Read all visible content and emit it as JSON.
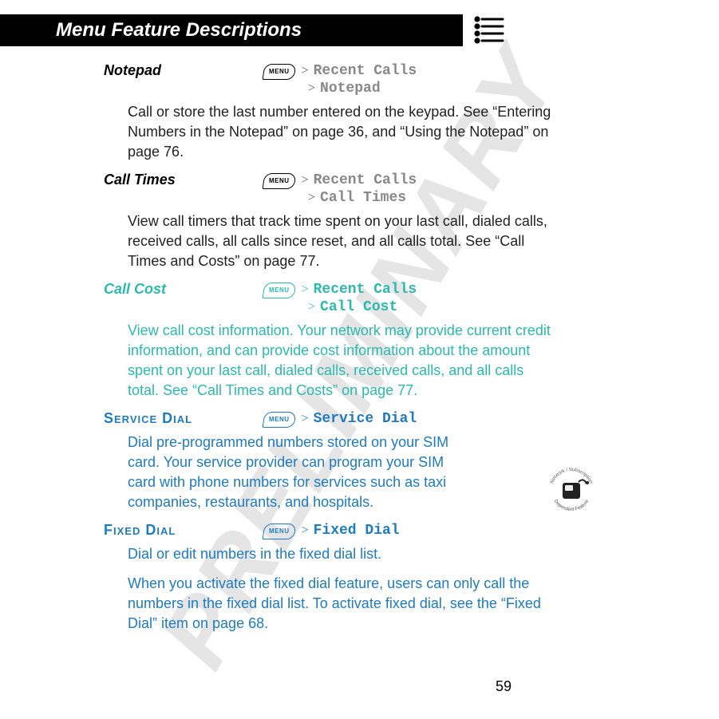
{
  "header": {
    "title": "Menu Feature Descriptions"
  },
  "watermark": "PRELIMINARY",
  "menu_button_label": "MENU",
  "sections": {
    "notepad": {
      "label": "Notepad",
      "crumb1": "Recent Calls",
      "crumb2": "Notepad",
      "body": "Call or store the last number entered on the keypad. See “Entering Numbers in the Notepad” on page 36, and “Using the Notepad” on page 76."
    },
    "calltimes": {
      "label": "Call Times",
      "crumb1": "Recent Calls",
      "crumb2": "Call Times",
      "body": "View call timers that track time spent on your last call, dialed calls, received calls, all calls since reset, and all calls total. See “Call Times and Costs” on page 77."
    },
    "callcost": {
      "label": "Call Cost",
      "crumb1": "Recent Calls",
      "crumb2": "Call Cost",
      "body": "View call cost information. Your network may provide current credit information, and can provide cost information about the amount spent on your last call, dialed calls, received calls, and all calls total. See “Call Times and Costs” on page 77."
    },
    "servicedial": {
      "label": "Service Dial",
      "crumb1": "Service Dial",
      "body": "Dial pre-programmed numbers stored on your SIM card. Your service provider can program your SIM card with phone numbers for services such as taxi companies, restaurants, and hospitals."
    },
    "fixeddial": {
      "label": "Fixed Dial",
      "crumb1": "Fixed Dial",
      "body1": "Dial or edit numbers in the fixed dial list.",
      "body2": "When you activate the fixed dial feature, users can only call the numbers in the fixed dial list. To activate fixed dial, see the “Fixed Dial” item on page 68."
    }
  },
  "page_number": "59",
  "badge_text_top": "Network / Subscription",
  "badge_text_bottom": "Dependent Feature"
}
